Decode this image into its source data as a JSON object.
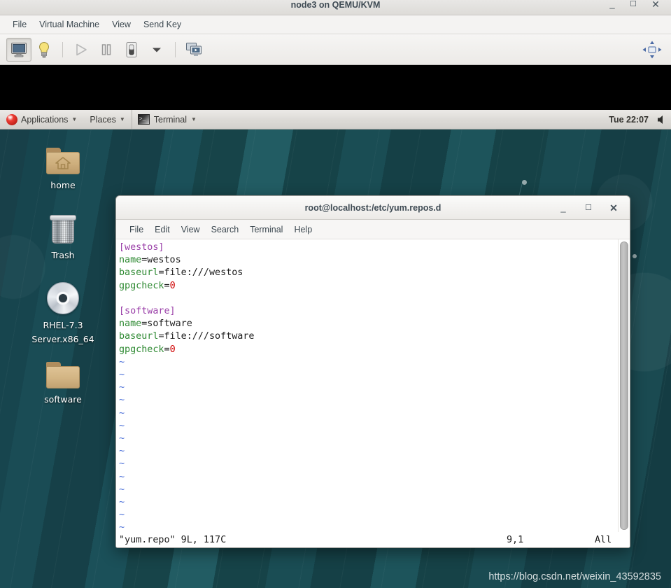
{
  "vm_window": {
    "title": "node3 on QEMU/KVM",
    "window_buttons": {
      "minimize": "_",
      "maximize": "☐",
      "close": "✕"
    },
    "menus": [
      "File",
      "Virtual Machine",
      "View",
      "Send Key"
    ],
    "toolbar": [
      {
        "name": "console-view-button",
        "icon": "monitor-icon",
        "state": "pressed"
      },
      {
        "name": "show-details-button",
        "icon": "lightbulb-icon",
        "state": "normal"
      },
      {
        "name": "run-button",
        "icon": "play-icon",
        "state": "disabled"
      },
      {
        "name": "pause-button",
        "icon": "pause-icon",
        "state": "normal"
      },
      {
        "name": "shutdown-button",
        "icon": "power-switch-icon",
        "state": "normal"
      },
      {
        "name": "shutdown-menu-button",
        "icon": "chevron-down-icon",
        "state": "normal"
      },
      {
        "name": "snapshots-button",
        "icon": "screens-icon",
        "state": "normal"
      },
      {
        "name": "fit-to-screen-button",
        "icon": "resize-arrows-icon",
        "state": "normal"
      }
    ]
  },
  "gnome_panel": {
    "logo": "redhat-logo-icon",
    "applications_label": "Applications",
    "places_label": "Places",
    "taskbar_item": "Terminal",
    "clock": "Tue 22:07",
    "volume_icon": "volume-icon"
  },
  "desktop": {
    "icons": [
      {
        "name": "desktop-icon-home",
        "label": "home",
        "icon": "home-folder-icon"
      },
      {
        "name": "desktop-icon-trash",
        "label": "Trash",
        "icon": "trash-icon"
      },
      {
        "name": "desktop-icon-rhel-iso",
        "label": "RHEL-7.3 Server.x86_64",
        "icon": "optical-disc-icon"
      },
      {
        "name": "desktop-icon-software",
        "label": "software",
        "icon": "folder-icon"
      }
    ]
  },
  "terminal": {
    "title": "root@localhost:/etc/yum.repos.d",
    "window_buttons": {
      "minimize": "_",
      "maximize": "☐",
      "close": "✕"
    },
    "menus": [
      "File",
      "Edit",
      "View",
      "Search",
      "Terminal",
      "Help"
    ],
    "editor": {
      "lines": [
        {
          "type": "section",
          "text": "[westos]"
        },
        {
          "type": "kv",
          "key": "name",
          "value": "westos"
        },
        {
          "type": "kv",
          "key": "baseurl",
          "value": "file:///westos"
        },
        {
          "type": "kvnum",
          "key": "gpgcheck",
          "value": "0"
        },
        {
          "type": "blank",
          "text": ""
        },
        {
          "type": "section",
          "text": "[software]"
        },
        {
          "type": "kv",
          "key": "name",
          "value": "software"
        },
        {
          "type": "kv",
          "key": "baseurl",
          "value": "file:///software"
        },
        {
          "type": "kvnum",
          "key": "gpgcheck",
          "value": "0"
        }
      ],
      "tilde_count": 14,
      "tilde_char": "~"
    },
    "status": {
      "file_info": "\"yum.repo\" 9L, 117C",
      "cursor_position": "9,1",
      "scroll_span": "All"
    }
  },
  "watermark": "https://blog.csdn.net/weixin_43592835",
  "colors": {
    "vim_section": "#9a3fa8",
    "vim_key": "#2f8a33",
    "vim_number": "#cf0000",
    "vim_tilde": "#4a6fd8",
    "desktop_bg": "#17444b"
  }
}
